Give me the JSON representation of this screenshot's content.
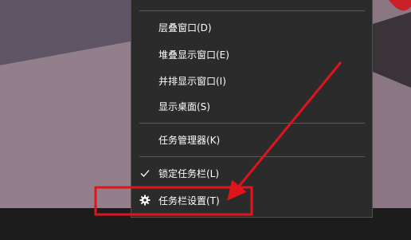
{
  "menu": {
    "items": [
      {
        "label": "层叠窗口(D)"
      },
      {
        "label": "堆叠显示窗口(E)"
      },
      {
        "label": "并排显示窗口(I)"
      },
      {
        "label": "显示桌面(S)"
      },
      {
        "label": "任务管理器(K)"
      },
      {
        "label": "锁定任务栏(L)",
        "checked": true
      },
      {
        "label": "任务栏设置(T)",
        "icon": "gear-icon"
      }
    ]
  },
  "annotation": {
    "highlight_color": "#e0141b",
    "arrow_color": "#e0141b",
    "highlighted_item": "任务栏设置(T)"
  },
  "colors": {
    "menu_bg": "#2b2b2b",
    "taskbar_bg": "#1c1c1c",
    "wallpaper": "#8f7b86"
  }
}
